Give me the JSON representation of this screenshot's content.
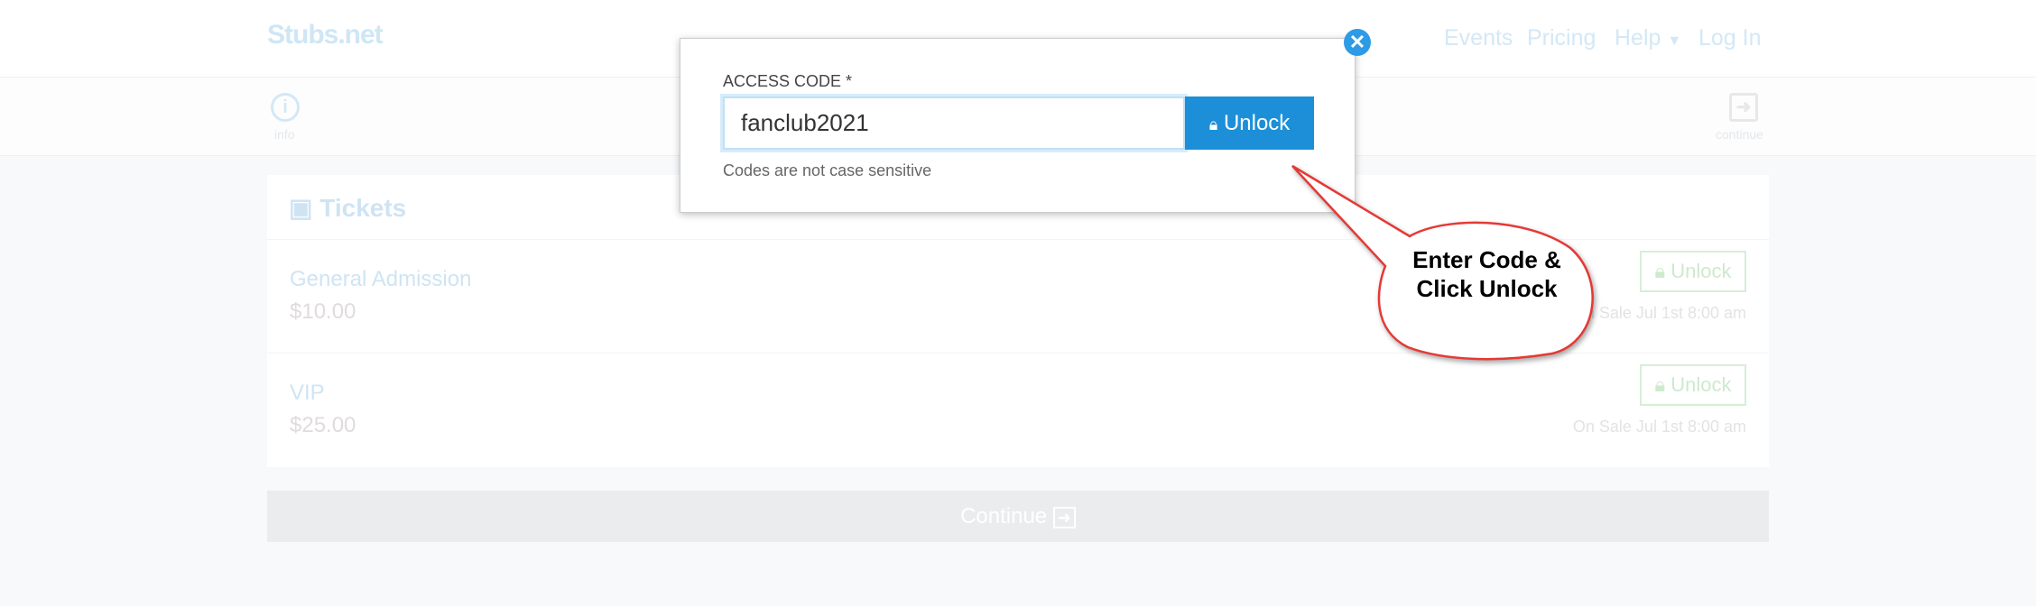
{
  "header": {
    "logo": "Stubs.net",
    "nav": [
      "Events",
      "Pricing",
      "Help",
      "Log In"
    ]
  },
  "steps": {
    "info": "info",
    "continue": "continue"
  },
  "tickets": {
    "title": "Tickets",
    "rows": [
      {
        "name": "General Admission",
        "price": "$10.00",
        "button": "Unlock",
        "sale": "On Sale Jul 1st 8:00 am"
      },
      {
        "name": "VIP",
        "price": "$25.00",
        "button": "Unlock",
        "sale": "On Sale Jul 1st 8:00 am"
      }
    ]
  },
  "continue_label": "Continue",
  "modal": {
    "label": "ACCESS CODE *",
    "value": "fanclub2021",
    "button": "Unlock",
    "hint": "Codes are not case sensitive"
  },
  "callout": "Enter Code & Click Unlock",
  "colors": {
    "accent": "#1c8fd8",
    "callout_border": "#e53935"
  }
}
